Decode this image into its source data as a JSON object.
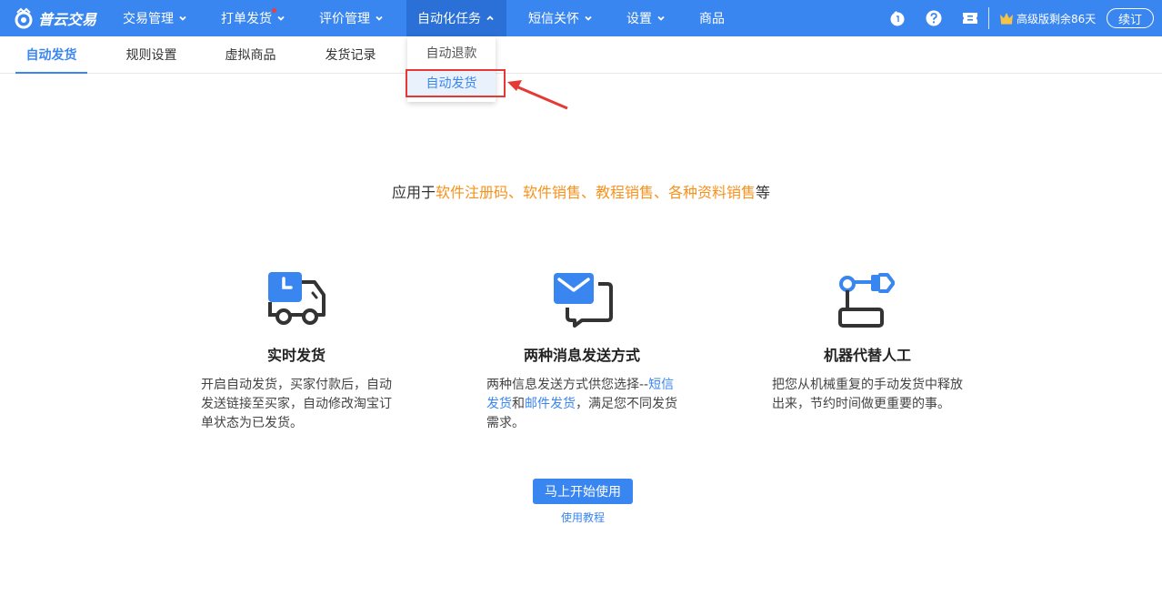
{
  "brand": {
    "name": "普云交易"
  },
  "topnav": {
    "items": [
      {
        "label": "交易管理",
        "has_dropdown": true
      },
      {
        "label": "打单发货",
        "has_dropdown": true,
        "has_badge": true
      },
      {
        "label": "评价管理",
        "has_dropdown": true
      },
      {
        "label": "自动化任务",
        "has_dropdown": true,
        "active": true
      },
      {
        "label": "短信关怀",
        "has_dropdown": true
      },
      {
        "label": "设置",
        "has_dropdown": true
      },
      {
        "label": "商品",
        "has_dropdown": false
      }
    ],
    "icons": [
      "notification-icon",
      "help-icon",
      "ticket-icon"
    ],
    "version_text": "高级版剩余86天",
    "renew_label": "续订"
  },
  "subnav": {
    "tabs": [
      {
        "label": "自动发货",
        "active": true
      },
      {
        "label": "规则设置"
      },
      {
        "label": "虚拟商品"
      },
      {
        "label": "发货记录"
      }
    ]
  },
  "dropdown": {
    "items": [
      {
        "label": "自动退款"
      },
      {
        "label": "自动发货",
        "selected": true
      }
    ]
  },
  "content": {
    "tagline": {
      "prefix": "应用于",
      "highlight": "软件注册码、软件销售、教程销售、各种资料销售",
      "suffix": "等"
    },
    "features": [
      {
        "icon": "delivery-truck-icon",
        "title": "实时发货",
        "desc": "开启自动发货，买家付款后，自动发送链接至买家，自动修改淘宝订单状态为已发货。"
      },
      {
        "icon": "message-icon",
        "title": "两种消息发送方式",
        "desc_prefix": "两种信息发送方式供您选择--",
        "desc_link1": "短信发货",
        "desc_and": "和",
        "desc_link2": "邮件发货",
        "desc_suffix": "，满足您不同发货需求。"
      },
      {
        "icon": "robot-arm-icon",
        "title": "机器代替人工",
        "desc": "把您从机械重复的手动发货中释放出来，节约时间做更重要的事。"
      }
    ],
    "start_button": "马上开始使用",
    "tutorial_link": "使用教程"
  },
  "colors": {
    "primary": "#3a86f0",
    "highlight": "#f7921e",
    "annotation": "#e53935"
  }
}
